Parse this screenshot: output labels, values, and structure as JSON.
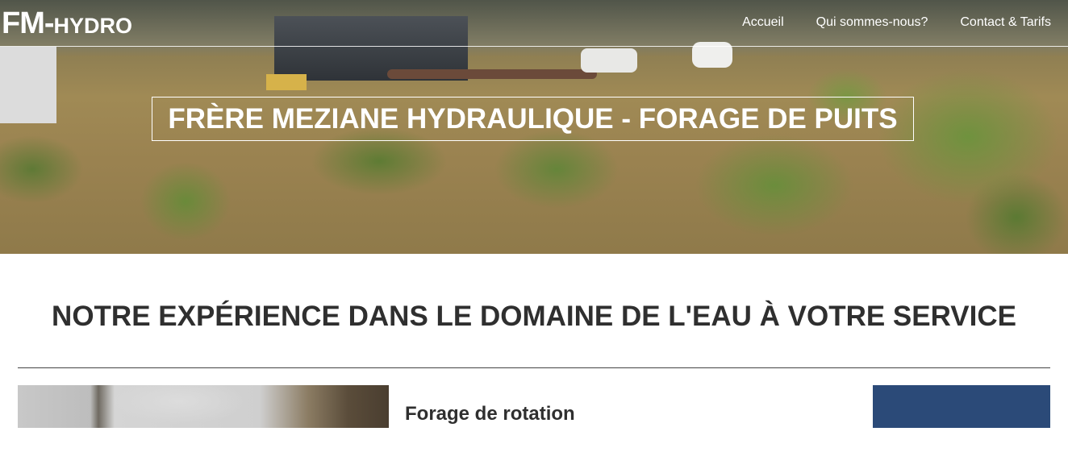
{
  "header": {
    "logo_big": "FM-",
    "logo_small": "HYDRO",
    "nav": [
      "Accueil",
      "Qui sommes-nous?",
      "Contact & Tarifs"
    ]
  },
  "hero": {
    "title": "FRÈRE MEZIANE HYDRAULIQUE - FORAGE DE PUITS"
  },
  "main": {
    "section_title": "NOTRE EXPÉRIENCE DANS LE DOMAINE DE L'EAU À VOTRE SERVICE",
    "services": [
      {
        "title": "Forage de rotation"
      }
    ]
  },
  "colors": {
    "accent_blue": "#2b4a78",
    "text_dark": "#2f2f2f"
  }
}
